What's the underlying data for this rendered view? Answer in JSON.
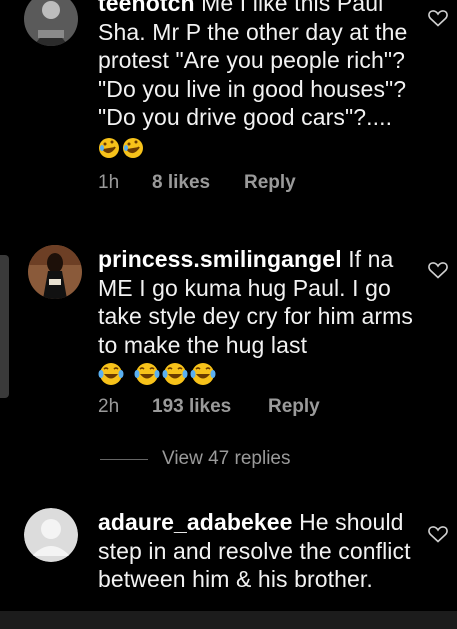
{
  "comments": [
    {
      "username": "teenotch",
      "text": "Me I like this Paul Sha. Mr P the other day at the protest \"Are you people rich\"? \"Do you live in good houses\"? \"Do you drive good cars\"?....",
      "time": "1h",
      "likes": "8 likes",
      "reply": "Reply",
      "emojis": [
        "rofl-emoji",
        "rofl-emoji"
      ]
    },
    {
      "username": "princess.smilingangel",
      "text": "If na ME I go kuma hug Paul. I go take style dey cry for him arms to make the hug last",
      "time": "2h",
      "likes": "193 likes",
      "reply": "Reply",
      "emojis": [
        "joy-emoji",
        "joy-emoji",
        "joy-emoji",
        "joy-emoji"
      ]
    },
    {
      "username": "adaure_adabekee",
      "text": "He should step in and resolve the conflict between him & his brother."
    }
  ],
  "view_replies": "View 47 replies",
  "colors": {
    "background": "#000000",
    "meta": "#9a9a9a",
    "emoji": "#f7c21a"
  }
}
